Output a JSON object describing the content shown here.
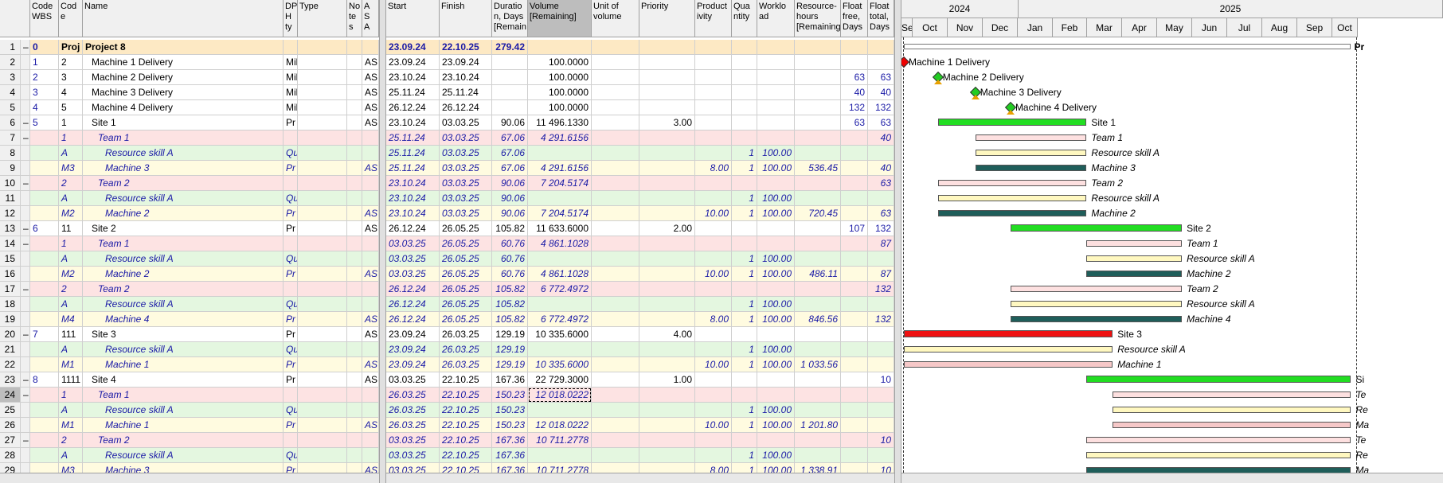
{
  "columns": [
    {
      "key": "wbs",
      "label": "Code WBS"
    },
    {
      "key": "code",
      "label": "Cod e"
    },
    {
      "key": "name",
      "label": "Name"
    },
    {
      "key": "dp",
      "label": "DP H ty"
    },
    {
      "key": "type",
      "label": "Type"
    },
    {
      "key": "notes",
      "label": "No te s"
    },
    {
      "key": "as",
      "label": "A S A"
    },
    {
      "key": "start",
      "label": "Start"
    },
    {
      "key": "finish",
      "label": "Finish"
    },
    {
      "key": "dur",
      "label": "Duratio n, Days [Remain"
    },
    {
      "key": "vol",
      "label": "Volume [Remaining]"
    },
    {
      "key": "unit",
      "label": "Unit of volume"
    },
    {
      "key": "prio",
      "label": "Priority"
    },
    {
      "key": "prod",
      "label": "Product ivity"
    },
    {
      "key": "qty",
      "label": "Qua ntity"
    },
    {
      "key": "work",
      "label": "Worklo ad"
    },
    {
      "key": "res",
      "label": "Resource- hours [Remaining"
    },
    {
      "key": "ffree",
      "label": "Float free, Days"
    },
    {
      "key": "ftot",
      "label": "Float total, Days"
    }
  ],
  "rows": [
    {
      "n": "1",
      "t": "–",
      "wbs": "0",
      "code": "Proj",
      "name": "Project 8",
      "dp": "",
      "as": "",
      "start": "23.09.24",
      "finish": "22.10.25",
      "dur": "279.42",
      "vol": "",
      "prio": "",
      "prod": "",
      "qty": "",
      "work": "",
      "res": "",
      "ffree": "",
      "ftot": "",
      "style": "project"
    },
    {
      "n": "2",
      "t": "",
      "wbs": "1",
      "code": "2",
      "name": "Machine 1 Delivery",
      "dp": "Mil",
      "as": "AS",
      "start": "23.09.24",
      "finish": "23.09.24",
      "dur": "",
      "vol": "100.0000",
      "prio": "",
      "prod": "",
      "qty": "",
      "work": "",
      "res": "",
      "ffree": "",
      "ftot": "",
      "style": "task"
    },
    {
      "n": "3",
      "t": "",
      "wbs": "2",
      "code": "3",
      "name": "Machine 2 Delivery",
      "dp": "Mil",
      "as": "AS",
      "start": "23.10.24",
      "finish": "23.10.24",
      "dur": "",
      "vol": "100.0000",
      "prio": "",
      "prod": "",
      "qty": "",
      "work": "",
      "res": "",
      "ffree": "63",
      "ftot": "63",
      "style": "task"
    },
    {
      "n": "4",
      "t": "",
      "wbs": "3",
      "code": "4",
      "name": "Machine 3 Delivery",
      "dp": "Mil",
      "as": "AS",
      "start": "25.11.24",
      "finish": "25.11.24",
      "dur": "",
      "vol": "100.0000",
      "prio": "",
      "prod": "",
      "qty": "",
      "work": "",
      "res": "",
      "ffree": "40",
      "ftot": "40",
      "style": "task"
    },
    {
      "n": "5",
      "t": "",
      "wbs": "4",
      "code": "5",
      "name": "Machine 4 Delivery",
      "dp": "Mil",
      "as": "AS",
      "start": "26.12.24",
      "finish": "26.12.24",
      "dur": "",
      "vol": "100.0000",
      "prio": "",
      "prod": "",
      "qty": "",
      "work": "",
      "res": "",
      "ffree": "132",
      "ftot": "132",
      "style": "task"
    },
    {
      "n": "6",
      "t": "–",
      "wbs": "5",
      "code": "1",
      "name": "Site 1",
      "dp": "Pr",
      "as": "AS",
      "start": "23.10.24",
      "finish": "03.03.25",
      "dur": "90.06",
      "vol": "11 496.1330",
      "prio": "3.00",
      "prod": "",
      "qty": "",
      "work": "",
      "res": "",
      "ffree": "63",
      "ftot": "63",
      "style": "task"
    },
    {
      "n": "7",
      "t": "–",
      "wbs": "",
      "code": "1",
      "name": "Team 1",
      "dp": "",
      "as": "",
      "start": "25.11.24",
      "finish": "03.03.25",
      "dur": "67.06",
      "vol": "4 291.6156",
      "prio": "",
      "prod": "",
      "qty": "",
      "work": "",
      "res": "",
      "ffree": "",
      "ftot": "40",
      "style": "team"
    },
    {
      "n": "8",
      "t": "",
      "wbs": "",
      "code": "A",
      "name": "Resource skill A",
      "dp": "Qu",
      "as": "",
      "start": "25.11.24",
      "finish": "03.03.25",
      "dur": "67.06",
      "vol": "",
      "prio": "",
      "prod": "",
      "qty": "1",
      "work": "100.00",
      "res": "",
      "ffree": "",
      "ftot": "",
      "style": "skill"
    },
    {
      "n": "9",
      "t": "",
      "wbs": "",
      "code": "M3",
      "name": "Machine 3",
      "dp": "Pr",
      "as": "AS",
      "start": "25.11.24",
      "finish": "03.03.25",
      "dur": "67.06",
      "vol": "4 291.6156",
      "prio": "",
      "prod": "8.00",
      "qty": "1",
      "work": "100.00",
      "res": "536.45",
      "ffree": "",
      "ftot": "40",
      "style": "machine"
    },
    {
      "n": "10",
      "t": "–",
      "wbs": "",
      "code": "2",
      "name": "Team 2",
      "dp": "",
      "as": "",
      "start": "23.10.24",
      "finish": "03.03.25",
      "dur": "90.06",
      "vol": "7 204.5174",
      "prio": "",
      "prod": "",
      "qty": "",
      "work": "",
      "res": "",
      "ffree": "",
      "ftot": "63",
      "style": "team"
    },
    {
      "n": "11",
      "t": "",
      "wbs": "",
      "code": "A",
      "name": "Resource skill A",
      "dp": "Qu",
      "as": "",
      "start": "23.10.24",
      "finish": "03.03.25",
      "dur": "90.06",
      "vol": "",
      "prio": "",
      "prod": "",
      "qty": "1",
      "work": "100.00",
      "res": "",
      "ffree": "",
      "ftot": "",
      "style": "skill"
    },
    {
      "n": "12",
      "t": "",
      "wbs": "",
      "code": "M2",
      "name": "Machine 2",
      "dp": "Pr",
      "as": "AS",
      "start": "23.10.24",
      "finish": "03.03.25",
      "dur": "90.06",
      "vol": "7 204.5174",
      "prio": "",
      "prod": "10.00",
      "qty": "1",
      "work": "100.00",
      "res": "720.45",
      "ffree": "",
      "ftot": "63",
      "style": "machine"
    },
    {
      "n": "13",
      "t": "–",
      "wbs": "6",
      "code": "11",
      "name": "Site 2",
      "dp": "Pr",
      "as": "AS",
      "start": "26.12.24",
      "finish": "26.05.25",
      "dur": "105.82",
      "vol": "11 633.6000",
      "prio": "2.00",
      "prod": "",
      "qty": "",
      "work": "",
      "res": "",
      "ffree": "107",
      "ftot": "132",
      "style": "task"
    },
    {
      "n": "14",
      "t": "–",
      "wbs": "",
      "code": "1",
      "name": "Team 1",
      "dp": "",
      "as": "",
      "start": "03.03.25",
      "finish": "26.05.25",
      "dur": "60.76",
      "vol": "4 861.1028",
      "prio": "",
      "prod": "",
      "qty": "",
      "work": "",
      "res": "",
      "ffree": "",
      "ftot": "87",
      "style": "team"
    },
    {
      "n": "15",
      "t": "",
      "wbs": "",
      "code": "A",
      "name": "Resource skill A",
      "dp": "Qu",
      "as": "",
      "start": "03.03.25",
      "finish": "26.05.25",
      "dur": "60.76",
      "vol": "",
      "prio": "",
      "prod": "",
      "qty": "1",
      "work": "100.00",
      "res": "",
      "ffree": "",
      "ftot": "",
      "style": "skill"
    },
    {
      "n": "16",
      "t": "",
      "wbs": "",
      "code": "M2",
      "name": "Machine 2",
      "dp": "Pr",
      "as": "AS",
      "start": "03.03.25",
      "finish": "26.05.25",
      "dur": "60.76",
      "vol": "4 861.1028",
      "prio": "",
      "prod": "10.00",
      "qty": "1",
      "work": "100.00",
      "res": "486.11",
      "ffree": "",
      "ftot": "87",
      "style": "machine"
    },
    {
      "n": "17",
      "t": "–",
      "wbs": "",
      "code": "2",
      "name": "Team 2",
      "dp": "",
      "as": "",
      "start": "26.12.24",
      "finish": "26.05.25",
      "dur": "105.82",
      "vol": "6 772.4972",
      "prio": "",
      "prod": "",
      "qty": "",
      "work": "",
      "res": "",
      "ffree": "",
      "ftot": "132",
      "style": "team"
    },
    {
      "n": "18",
      "t": "",
      "wbs": "",
      "code": "A",
      "name": "Resource skill A",
      "dp": "Qu",
      "as": "",
      "start": "26.12.24",
      "finish": "26.05.25",
      "dur": "105.82",
      "vol": "",
      "prio": "",
      "prod": "",
      "qty": "1",
      "work": "100.00",
      "res": "",
      "ffree": "",
      "ftot": "",
      "style": "skill"
    },
    {
      "n": "19",
      "t": "",
      "wbs": "",
      "code": "M4",
      "name": "Machine 4",
      "dp": "Pr",
      "as": "AS",
      "start": "26.12.24",
      "finish": "26.05.25",
      "dur": "105.82",
      "vol": "6 772.4972",
      "prio": "",
      "prod": "8.00",
      "qty": "1",
      "work": "100.00",
      "res": "846.56",
      "ffree": "",
      "ftot": "132",
      "style": "machine"
    },
    {
      "n": "20",
      "t": "–",
      "wbs": "7",
      "code": "111",
      "name": "Site 3",
      "dp": "Pr",
      "as": "AS",
      "start": "23.09.24",
      "finish": "26.03.25",
      "dur": "129.19",
      "vol": "10 335.6000",
      "prio": "4.00",
      "prod": "",
      "qty": "",
      "work": "",
      "res": "",
      "ffree": "",
      "ftot": "",
      "style": "task"
    },
    {
      "n": "21",
      "t": "",
      "wbs": "",
      "code": "A",
      "name": "Resource skill A",
      "dp": "Qu",
      "as": "",
      "start": "23.09.24",
      "finish": "26.03.25",
      "dur": "129.19",
      "vol": "",
      "prio": "",
      "prod": "",
      "qty": "1",
      "work": "100.00",
      "res": "",
      "ffree": "",
      "ftot": "",
      "style": "skill"
    },
    {
      "n": "22",
      "t": "",
      "wbs": "",
      "code": "M1",
      "name": "Machine 1",
      "dp": "Pr",
      "as": "AS",
      "start": "23.09.24",
      "finish": "26.03.25",
      "dur": "129.19",
      "vol": "10 335.6000",
      "prio": "",
      "prod": "10.00",
      "qty": "1",
      "work": "100.00",
      "res": "1 033.56",
      "ffree": "",
      "ftot": "",
      "style": "machine"
    },
    {
      "n": "23",
      "t": "–",
      "wbs": "8",
      "code": "1111",
      "name": "Site 4",
      "dp": "Pr",
      "as": "AS",
      "start": "03.03.25",
      "finish": "22.10.25",
      "dur": "167.36",
      "vol": "22 729.3000",
      "prio": "1.00",
      "prod": "",
      "qty": "",
      "work": "",
      "res": "",
      "ffree": "",
      "ftot": "10",
      "style": "task"
    },
    {
      "n": "24",
      "t": "–",
      "wbs": "",
      "code": "1",
      "name": "Team 1",
      "dp": "",
      "as": "",
      "start": "26.03.25",
      "finish": "22.10.25",
      "dur": "150.23",
      "vol": "12 018.0222",
      "prio": "",
      "prod": "",
      "qty": "",
      "work": "",
      "res": "",
      "ffree": "",
      "ftot": "",
      "style": "team"
    },
    {
      "n": "25",
      "t": "",
      "wbs": "",
      "code": "A",
      "name": "Resource skill A",
      "dp": "Qu",
      "as": "",
      "start": "26.03.25",
      "finish": "22.10.25",
      "dur": "150.23",
      "vol": "",
      "prio": "",
      "prod": "",
      "qty": "1",
      "work": "100.00",
      "res": "",
      "ffree": "",
      "ftot": "",
      "style": "skill"
    },
    {
      "n": "26",
      "t": "",
      "wbs": "",
      "code": "M1",
      "name": "Machine 1",
      "dp": "Pr",
      "as": "AS",
      "start": "26.03.25",
      "finish": "22.10.25",
      "dur": "150.23",
      "vol": "12 018.0222",
      "prio": "",
      "prod": "10.00",
      "qty": "1",
      "work": "100.00",
      "res": "1 201.80",
      "ffree": "",
      "ftot": "",
      "style": "machine"
    },
    {
      "n": "27",
      "t": "–",
      "wbs": "",
      "code": "2",
      "name": "Team 2",
      "dp": "",
      "as": "",
      "start": "03.03.25",
      "finish": "22.10.25",
      "dur": "167.36",
      "vol": "10 711.2778",
      "prio": "",
      "prod": "",
      "qty": "",
      "work": "",
      "res": "",
      "ffree": "",
      "ftot": "10",
      "style": "team"
    },
    {
      "n": "28",
      "t": "",
      "wbs": "",
      "code": "A",
      "name": "Resource skill A",
      "dp": "Qu",
      "as": "",
      "start": "03.03.25",
      "finish": "22.10.25",
      "dur": "167.36",
      "vol": "",
      "prio": "",
      "prod": "",
      "qty": "1",
      "work": "100.00",
      "res": "",
      "ffree": "",
      "ftot": "",
      "style": "skill"
    },
    {
      "n": "29",
      "t": "",
      "wbs": "",
      "code": "M3",
      "name": "Machine 3",
      "dp": "Pr",
      "as": "AS",
      "start": "03.03.25",
      "finish": "22.10.25",
      "dur": "167.36",
      "vol": "10 711.2778",
      "prio": "",
      "prod": "8.00",
      "qty": "1",
      "work": "100.00",
      "res": "1 338.91",
      "ffree": "",
      "ftot": "10",
      "style": "machine"
    }
  ],
  "timeline": {
    "years": [
      "2024",
      "2025"
    ],
    "months": [
      "Se",
      "Oct",
      "Nov",
      "Dec",
      "Jan",
      "Feb",
      "Mar",
      "Apr",
      "May",
      "Jun",
      "Jul",
      "Aug",
      "Sep",
      "Oct"
    ]
  },
  "gantt": [
    {
      "row": 1,
      "kind": "summary",
      "label": "Pr"
    },
    {
      "row": 2,
      "kind": "milestone-red",
      "label": "Machine 1 Delivery"
    },
    {
      "row": 3,
      "kind": "milestone",
      "label": "Machine 2 Delivery"
    },
    {
      "row": 4,
      "kind": "milestone",
      "label": "Machine 3 Delivery"
    },
    {
      "row": 5,
      "kind": "milestone",
      "label": "Machine 4 Delivery"
    },
    {
      "row": 6,
      "kind": "green",
      "label": "Site 1"
    },
    {
      "row": 7,
      "kind": "pink",
      "label": "Team 1"
    },
    {
      "row": 8,
      "kind": "yellow",
      "label": "Resource skill A"
    },
    {
      "row": 9,
      "kind": "teal",
      "label": "Machine 3"
    },
    {
      "row": 10,
      "kind": "pink",
      "label": "Team 2"
    },
    {
      "row": 11,
      "kind": "yellow",
      "label": "Resource skill A"
    },
    {
      "row": 12,
      "kind": "teal",
      "label": "Machine 2"
    },
    {
      "row": 13,
      "kind": "green",
      "label": "Site 2"
    },
    {
      "row": 14,
      "kind": "pink",
      "label": "Team 1"
    },
    {
      "row": 15,
      "kind": "yellow",
      "label": "Resource skill A"
    },
    {
      "row": 16,
      "kind": "teal",
      "label": "Machine 2"
    },
    {
      "row": 17,
      "kind": "pink",
      "label": "Team 2"
    },
    {
      "row": 18,
      "kind": "yellow",
      "label": "Resource skill A"
    },
    {
      "row": 19,
      "kind": "teal",
      "label": "Machine 4"
    },
    {
      "row": 20,
      "kind": "red",
      "label": "Site 3"
    },
    {
      "row": 21,
      "kind": "yellow",
      "label": "Resource skill A"
    },
    {
      "row": 22,
      "kind": "salmon",
      "label": "Machine 1"
    },
    {
      "row": 23,
      "kind": "green",
      "label": "Si"
    },
    {
      "row": 24,
      "kind": "pink",
      "label": "Te"
    },
    {
      "row": 25,
      "kind": "yellow",
      "label": "Re"
    },
    {
      "row": 26,
      "kind": "salmon",
      "label": "Ma"
    },
    {
      "row": 27,
      "kind": "pink",
      "label": "Te"
    },
    {
      "row": 28,
      "kind": "yellow",
      "label": "Re"
    },
    {
      "row": 29,
      "kind": "teal",
      "label": "Ma"
    }
  ],
  "colors": {
    "project": "#fde9c4",
    "task": "#ffffff",
    "team": "#fde3e3",
    "skill": "#e4f7e0",
    "machine": "#fffbe0",
    "green": "#22dd22",
    "pink": "#fde0e0",
    "yellow": "#fff8c0",
    "teal": "#1f5e5a",
    "red": "#ee1111",
    "salmon": "#f6c8c8"
  },
  "selected_row": "24"
}
